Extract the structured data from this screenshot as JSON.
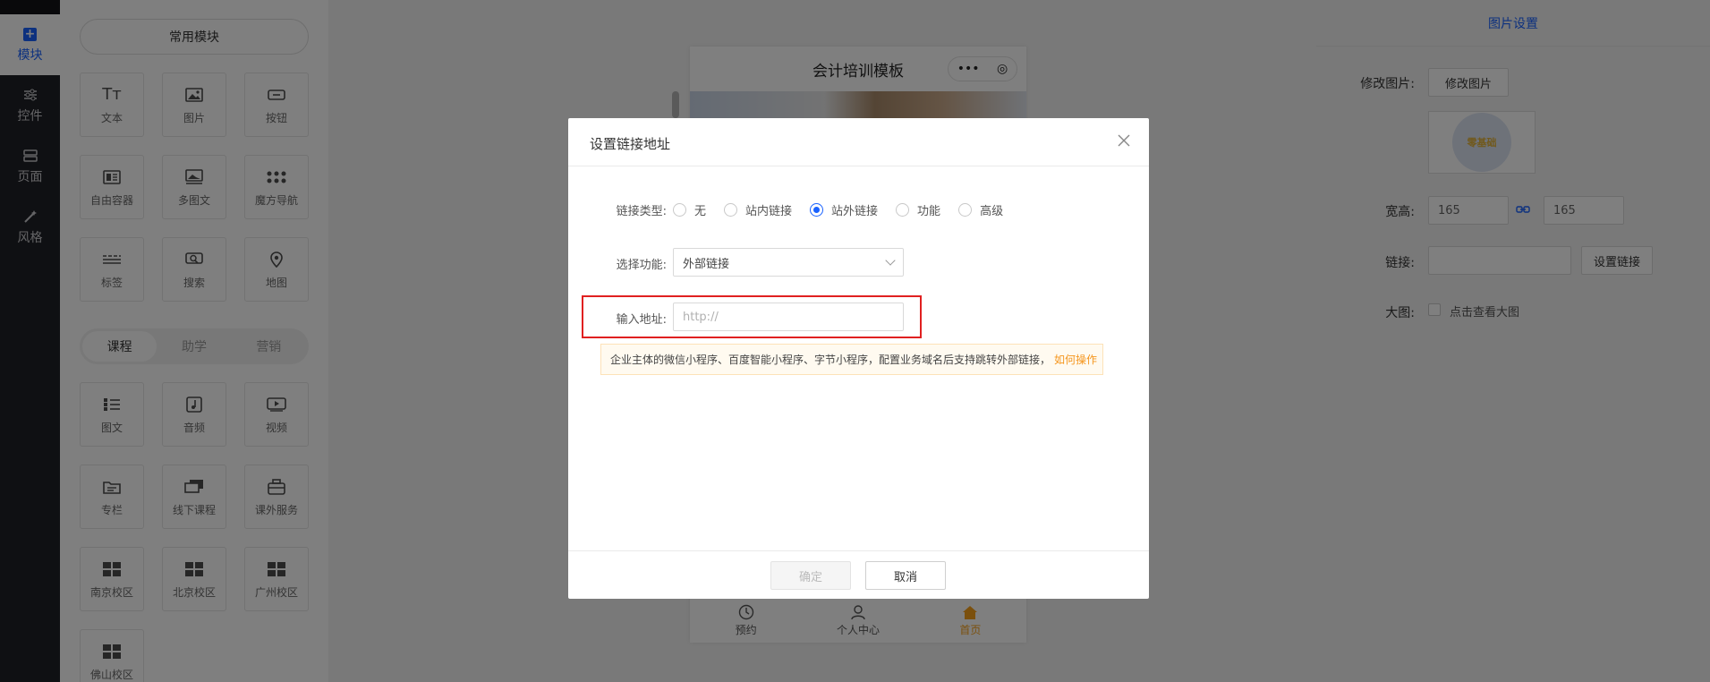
{
  "nav": {
    "items": [
      {
        "label": "模块",
        "icon": "plus-square-icon"
      },
      {
        "label": "控件",
        "icon": "sliders-icon"
      },
      {
        "label": "页面",
        "icon": "page-icon"
      },
      {
        "label": "风格",
        "icon": "magic-wand-icon"
      }
    ]
  },
  "modules": {
    "common_label": "常用模块",
    "common": [
      "文本",
      "图片",
      "按钮",
      "自由容器",
      "多图文",
      "魔方导航",
      "标签",
      "搜索",
      "地图"
    ],
    "tabs": [
      "课程",
      "助学",
      "营销"
    ],
    "course": [
      "图文",
      "音频",
      "视频",
      "专栏",
      "线下课程",
      "课外服务",
      "南京校区",
      "北京校区",
      "广州校区",
      "佛山校区"
    ]
  },
  "phone": {
    "title": "会计培训模板",
    "capsule_more": "•••",
    "capsule_target": "◎",
    "tabs": [
      {
        "label": "预约",
        "icon": "clock-icon"
      },
      {
        "label": "个人中心",
        "icon": "user-icon"
      },
      {
        "label": "首页",
        "icon": "home-icon"
      }
    ]
  },
  "settings": {
    "title": "图片设置",
    "modify_label": "修改图片:",
    "modify_button": "修改图片",
    "thumb_text": "零基础",
    "size_label": "宽高:",
    "width": "165",
    "height": "165",
    "link_label": "链接:",
    "link_value": "",
    "set_link_button": "设置链接",
    "large_label": "大图:",
    "large_check_label": "点击查看大图"
  },
  "dialog": {
    "title": "设置链接地址",
    "link_type_label": "链接类型:",
    "link_types": [
      "无",
      "站内链接",
      "站外链接",
      "功能",
      "高级"
    ],
    "selected_type": "站外链接",
    "function_label": "选择功能:",
    "function_value": "外部链接",
    "address_label": "输入地址:",
    "address_placeholder": "http://",
    "notice_text": "企业主体的微信小程序、百度智能小程序、字节小程序，配置业务域名后支持跳转外部链接，",
    "notice_link": "如何操作",
    "ok_button": "确定",
    "cancel_button": "取消"
  },
  "colors": {
    "accent": "#1a62ff",
    "warning": "#f5961e",
    "highlight_border": "#e02020",
    "home_active": "#f7a01a"
  }
}
